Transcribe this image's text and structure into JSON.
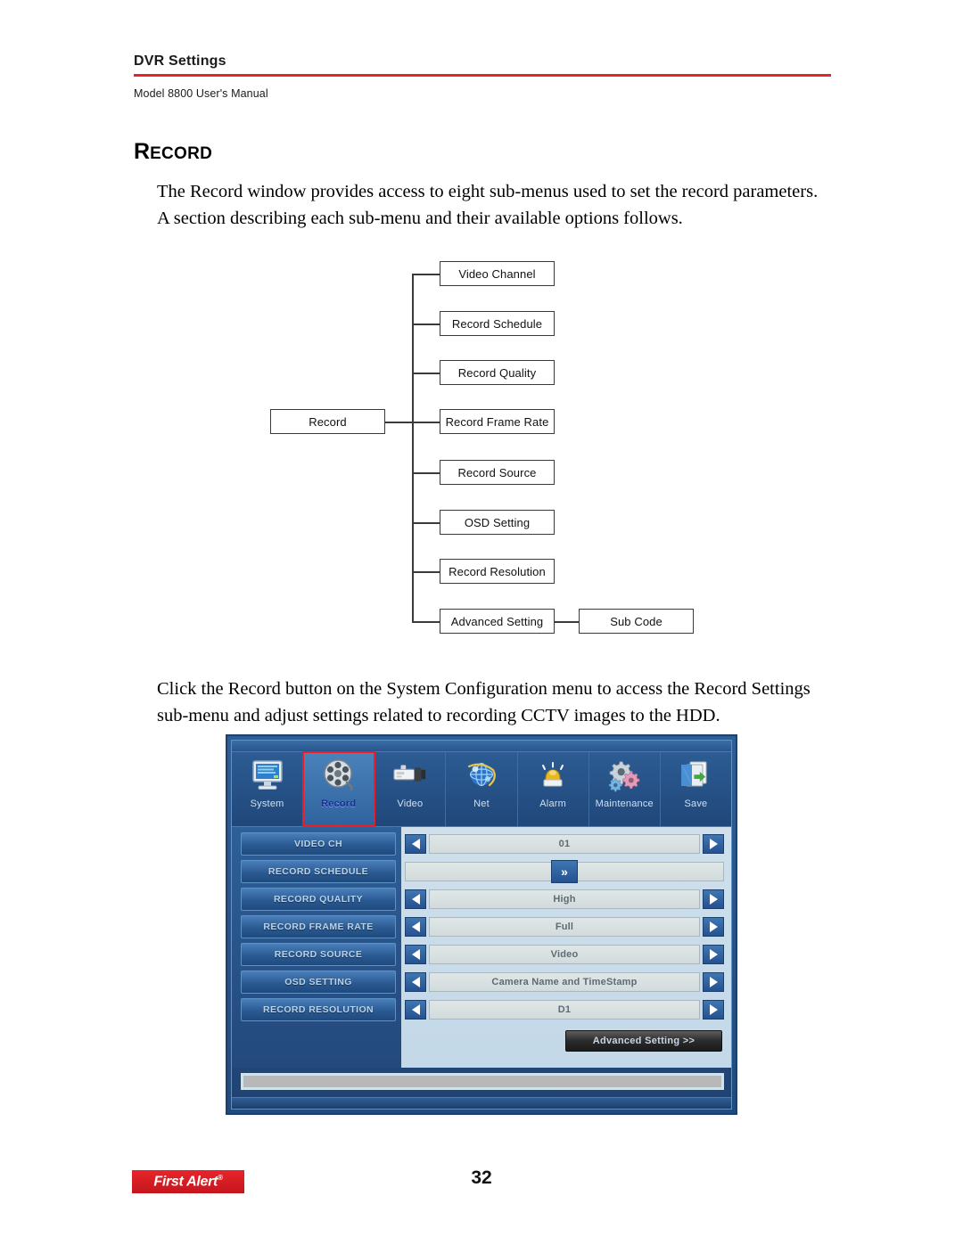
{
  "header": {
    "title": "DVR Settings",
    "subtitle": "Model 8800 User's Manual",
    "rule_color": "#e8252a"
  },
  "section": {
    "heading_first_letter": "R",
    "heading_rest": "ECORD",
    "heading_full": "RECORD"
  },
  "paragraphs": {
    "intro_line1": "The Record window provides access to eight sub-menus used to set the record parameters.",
    "intro_line2": "A section describing each sub-menu and their available options follows.",
    "access_line1": "Click the Record button on the System Configuration menu to access the Record Settings",
    "access_line2": "sub-menu and adjust settings related to recording CCTV images to the HDD."
  },
  "diagram": {
    "root": "Record",
    "children": [
      "Video Channel",
      "Record Schedule",
      "Record Quality",
      "Record Frame Rate",
      "Record Source",
      "OSD Setting",
      "Record Resolution",
      "Advanced Setting"
    ],
    "grandchild": "Sub Code"
  },
  "dvr": {
    "toolbar": [
      {
        "label": "System",
        "icon": "monitor-icon",
        "selected": false
      },
      {
        "label": "Record",
        "icon": "film-reel-icon",
        "selected": true
      },
      {
        "label": "Video",
        "icon": "camera-icon",
        "selected": false
      },
      {
        "label": "Net",
        "icon": "globe-network-icon",
        "selected": false
      },
      {
        "label": "Alarm",
        "icon": "siren-icon",
        "selected": false
      },
      {
        "label": "Maintenance",
        "icon": "gears-icon",
        "selected": false
      },
      {
        "label": "Save",
        "icon": "save-document-icon",
        "selected": false
      }
    ],
    "selection_outline_color": "#ee1c24",
    "menu_buttons": [
      "VIDEO CH",
      "RECORD SCHEDULE",
      "RECORD QUALITY",
      "RECORD FRAME RATE",
      "RECORD SOURCE",
      "OSD SETTING",
      "RECORD RESOLUTION"
    ],
    "values": {
      "video_ch": "01",
      "record_schedule_button": "»",
      "record_quality": "High",
      "record_frame_rate": "Full",
      "record_source": "Video",
      "osd_setting": "Camera Name and TimeStamp",
      "record_resolution": "D1"
    },
    "advanced_button": "Advanced Setting >>"
  },
  "footer": {
    "logo_text": "First Alert",
    "logo_mark": "®",
    "page_number": "32"
  }
}
